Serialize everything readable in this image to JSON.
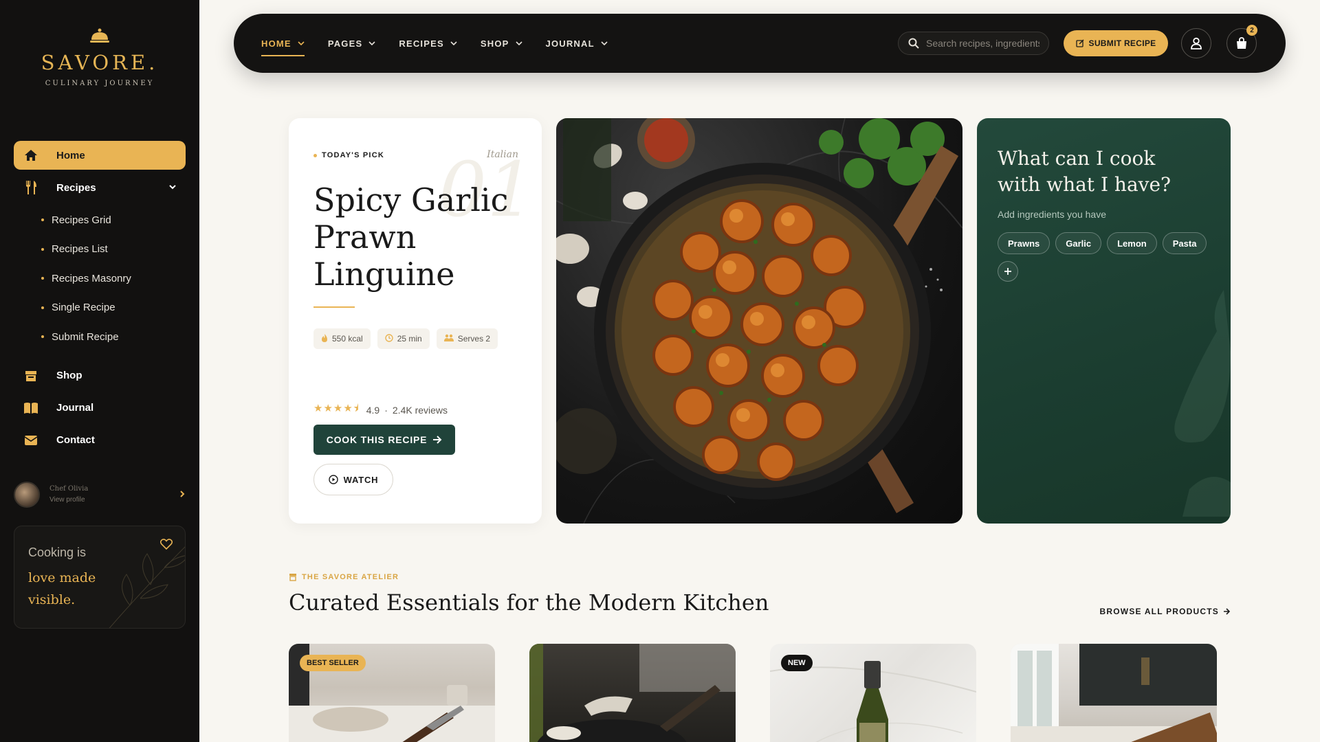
{
  "brand": {
    "name": "SAVORE.",
    "tagline": "CULINARY JOURNEY"
  },
  "sidebar": {
    "items": [
      {
        "label": "Home",
        "icon": "home-icon"
      },
      {
        "label": "Recipes",
        "icon": "utensils-icon"
      },
      {
        "label": "Shop",
        "icon": "store-icon"
      },
      {
        "label": "Journal",
        "icon": "book-icon"
      },
      {
        "label": "Contact",
        "icon": "mail-icon"
      }
    ],
    "recipes_sub": [
      "Recipes Grid",
      "Recipes List",
      "Recipes Masonry",
      "Single Recipe",
      "Submit Recipe"
    ],
    "profile": {
      "name": "Chef Olivia",
      "action": "View profile"
    },
    "quote": {
      "line1": "Cooking is",
      "line2": "love made",
      "line3": "visible."
    }
  },
  "topnav": {
    "items": [
      "HOME",
      "PAGES",
      "RECIPES",
      "SHOP",
      "JOURNAL"
    ],
    "search_placeholder": "Search recipes, ingredients...",
    "submit_label": "SUBMIT RECIPE",
    "cart_count": "2"
  },
  "featured": {
    "label": "TODAY'S PICK",
    "cuisine": "Italian",
    "number": "01",
    "title": "Spicy Garlic Prawn Linguine",
    "kcal": "550 kcal",
    "time": "25 min",
    "serves": "Serves 2",
    "stars": "★★★★⯨",
    "rating": "4.9",
    "reviews": "2.4K reviews",
    "cook_label": "COOK THIS RECIPE",
    "watch_label": "WATCH"
  },
  "ingredients": {
    "title": "What can I cook with what I have?",
    "subtitle": "Add ingredients you have",
    "tags": [
      "Prawns",
      "Garlic",
      "Lemon",
      "Pasta"
    ]
  },
  "shop_section": {
    "label": "THE SAVORE ATELIER",
    "title": "Curated Essentials for the Modern Kitchen",
    "browse": "BROWSE ALL PRODUCTS",
    "badges": {
      "first": "BEST SELLER",
      "third": "NEW"
    }
  },
  "colors": {
    "accent": "#e9b454",
    "dark": "#121110",
    "green": "#20433a"
  }
}
